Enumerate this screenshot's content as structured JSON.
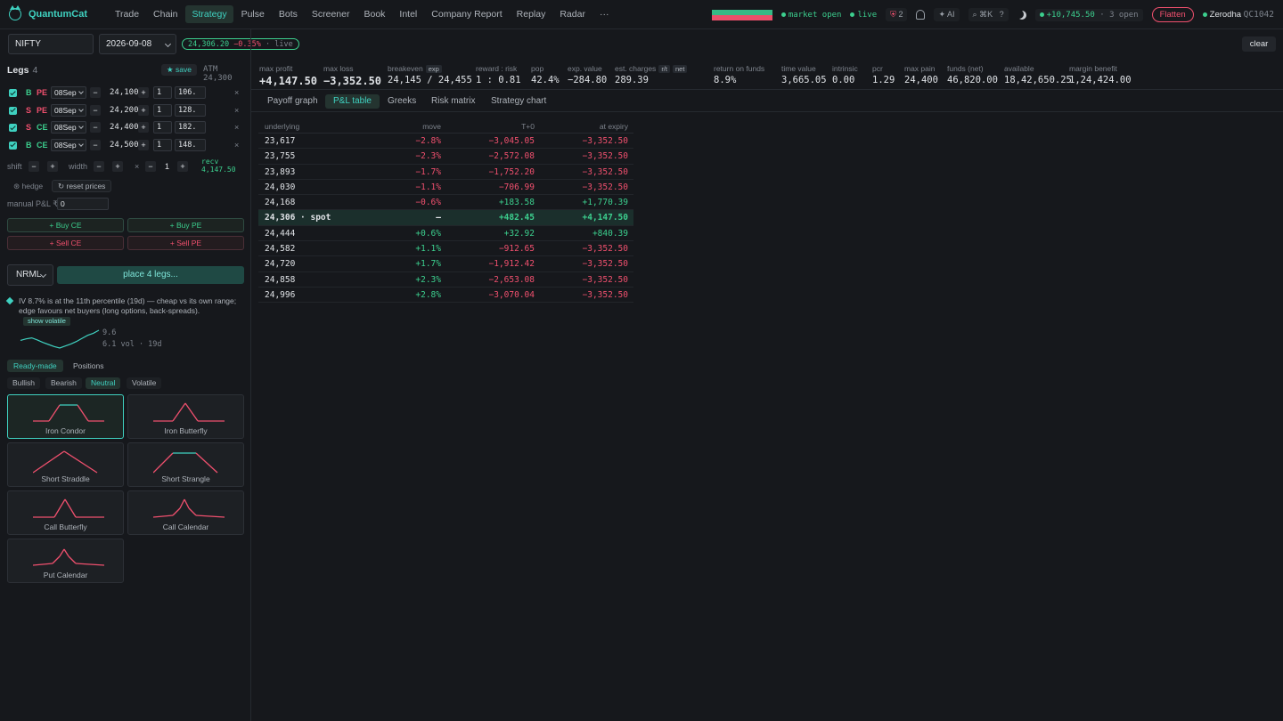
{
  "nav": {
    "brand": "QuantumCat",
    "items": [
      "Trade",
      "Chain",
      "Strategy",
      "Pulse",
      "Bots",
      "Screener",
      "Book",
      "Intel",
      "Company Report",
      "Replay",
      "Radar",
      "···"
    ],
    "active": "Strategy",
    "market_status": "market open",
    "live_status": "live",
    "alerts_count": "2",
    "ai_label": "✦ AI",
    "shortcut": "⌘K",
    "help": "?",
    "pnl_summary": "+10,745.50",
    "open_count": "· 3 open",
    "flatten_label": "Flatten",
    "broker": "Zerodha",
    "client_id": "QC1042"
  },
  "symbolbar": {
    "symbol": "NIFTY",
    "expiry": "2026-09-08",
    "spot_price": "24,306.20",
    "spot_change": "−0.35%",
    "live_tag": "· live",
    "clear_label": "clear"
  },
  "legs": {
    "title": "Legs",
    "count": "4",
    "save_label": "★ save",
    "atm_label": "ATM 24,300",
    "rows": [
      {
        "side": "B",
        "type": "PE",
        "expiry": "08Sep",
        "strike": "24,100",
        "qty": "1",
        "price": "106."
      },
      {
        "side": "S",
        "type": "PE",
        "expiry": "08Sep",
        "strike": "24,200",
        "qty": "1",
        "price": "128."
      },
      {
        "side": "S",
        "type": "CE",
        "expiry": "08Sep",
        "strike": "24,400",
        "qty": "1",
        "price": "182."
      },
      {
        "side": "B",
        "type": "CE",
        "expiry": "08Sep",
        "strike": "24,500",
        "qty": "1",
        "price": "148."
      }
    ],
    "remove_label": "×",
    "minus": "−",
    "plus": "+",
    "shift_label": "shift",
    "width_label": "width",
    "times_label": "×",
    "multiplier": "1",
    "recv_label": "recv",
    "recv_value": "4,147.50",
    "hedge_label": "⊛ hedge",
    "reset_label": "↻ reset prices",
    "manual_label": "manual P&L ₹",
    "manual_value": "0"
  },
  "quick": {
    "buy_ce": "+ Buy CE",
    "buy_pe": "+ Buy PE",
    "sell_ce": "+ Sell CE",
    "sell_pe": "+ Sell PE"
  },
  "order": {
    "product": "NRML",
    "place_label": "place 4 legs..."
  },
  "iv": {
    "note": "IV 8.7% is at the 11th percentile (19d) — cheap vs its own range; edge favours net buyers (long options, back-spreads).",
    "show_label": "show volatile",
    "high": "9.6",
    "low": "6.1 vol · 19d",
    "series": [
      7.6,
      7.9,
      8.1,
      7.7,
      7.2,
      6.8,
      6.4,
      6.1,
      6.5,
      6.9,
      7.4,
      8.0,
      8.6,
      9.0,
      9.6
    ]
  },
  "strategies": {
    "tabs": [
      "Ready-made",
      "Positions"
    ],
    "active_tab": "Ready-made",
    "filters": [
      "Bullish",
      "Bearish",
      "Neutral",
      "Volatile"
    ],
    "active_filter": "Neutral",
    "cards": [
      "Iron Condor",
      "Iron Butterfly",
      "Short Straddle",
      "Short Strangle",
      "Call Butterfly",
      "Call Calendar",
      "Put Calendar"
    ],
    "selected": "Iron Condor"
  },
  "metrics": [
    {
      "label": "max profit",
      "value": "+4,147.50",
      "tone": "green",
      "big": true
    },
    {
      "label": "max loss",
      "value": "−3,352.50",
      "tone": "red",
      "big": true
    },
    {
      "label": "breakeven",
      "tag": "exp",
      "value": "24,145 / 24,455"
    },
    {
      "label": "reward : risk",
      "value": "1 : 0.81"
    },
    {
      "label": "pop",
      "value": "42.4%"
    },
    {
      "label": "exp. value",
      "value": "−284.80",
      "tone": "red"
    },
    {
      "label": "est. charges",
      "tag": "r/t",
      "tag2": "net",
      "value": "289.39"
    },
    {
      "label": "return on funds",
      "value": "8.9%"
    },
    {
      "label": "time value",
      "value": "3,665.05"
    },
    {
      "label": "intrinsic",
      "value": "0.00"
    },
    {
      "label": "pcr",
      "value": "1.29"
    },
    {
      "label": "max pain",
      "value": "24,400"
    },
    {
      "label": "funds (net)",
      "value": "46,820.00"
    },
    {
      "label": "available",
      "value": "18,42,650.25"
    },
    {
      "label": "margin benefit",
      "value": "1,24,424.00",
      "tone": "green"
    }
  ],
  "subtabs": [
    "Payoff graph",
    "P&L table",
    "Greeks",
    "Risk matrix",
    "Strategy chart"
  ],
  "active_subtab": "P&L table",
  "pl_table": {
    "headers": [
      "underlying",
      "move",
      "T+0",
      "at expiry"
    ],
    "rows": [
      {
        "underlying": "23,617",
        "move": "−2.8%",
        "t0": "−3,045.05",
        "expiry": "−3,352.50"
      },
      {
        "underlying": "23,755",
        "move": "−2.3%",
        "t0": "−2,572.08",
        "expiry": "−3,352.50"
      },
      {
        "underlying": "23,893",
        "move": "−1.7%",
        "t0": "−1,752.20",
        "expiry": "−3,352.50"
      },
      {
        "underlying": "24,030",
        "move": "−1.1%",
        "t0": "−706.99",
        "expiry": "−3,352.50"
      },
      {
        "underlying": "24,168",
        "move": "−0.6%",
        "t0": "+183.58",
        "expiry": "+1,770.39"
      },
      {
        "underlying": "24,306 · spot",
        "move": "—",
        "t0": "+482.45",
        "expiry": "+4,147.50",
        "spot": true
      },
      {
        "underlying": "24,444",
        "move": "+0.6%",
        "t0": "+32.92",
        "expiry": "+840.39"
      },
      {
        "underlying": "24,582",
        "move": "+1.1%",
        "t0": "−912.65",
        "expiry": "−3,352.50"
      },
      {
        "underlying": "24,720",
        "move": "+1.7%",
        "t0": "−1,912.42",
        "expiry": "−3,352.50"
      },
      {
        "underlying": "24,858",
        "move": "+2.3%",
        "t0": "−2,653.08",
        "expiry": "−3,352.50"
      },
      {
        "underlying": "24,996",
        "move": "+2.8%",
        "t0": "−3,070.04",
        "expiry": "−3,352.50"
      }
    ]
  },
  "colors": {
    "accent": "#3fd1c0",
    "green": "#3ccf8e",
    "red": "#f0506e",
    "bg": "#16181c"
  }
}
